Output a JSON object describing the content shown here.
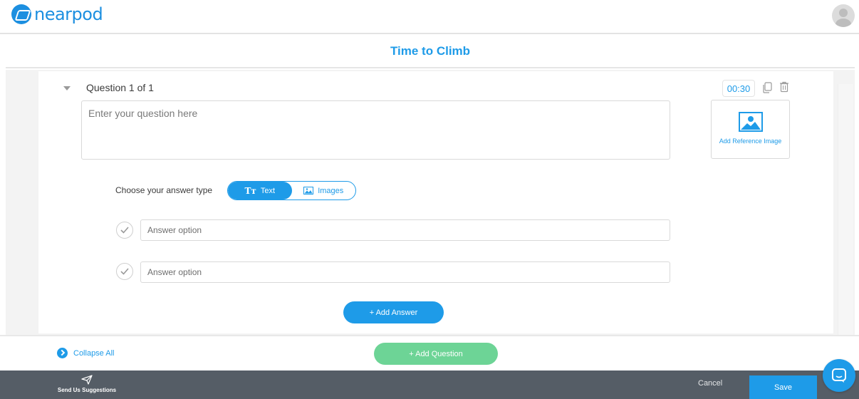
{
  "app": {
    "brand": "nearpod"
  },
  "page": {
    "title": "Time to Climb"
  },
  "question": {
    "label": "Question 1 of 1",
    "timer": "00:30",
    "placeholder": "Enter your question here",
    "reference_image_label": "Add Reference Image"
  },
  "answer_type": {
    "label": "Choose your answer type",
    "options": [
      {
        "label": "Text",
        "icon": "text-type-icon",
        "selected": true
      },
      {
        "label": "Images",
        "icon": "image-icon",
        "selected": false
      }
    ]
  },
  "answers": [
    {
      "placeholder": "Answer option"
    },
    {
      "placeholder": "Answer option"
    }
  ],
  "buttons": {
    "add_answer": "+ Add Answer",
    "add_question": "+ Add Question",
    "collapse_all": "Collapse All",
    "send_suggestions": "Send Us Suggestions",
    "cancel": "Cancel",
    "save": "Save"
  },
  "colors": {
    "primary": "#1e9be8",
    "add_question": "#6dd496",
    "footer": "#555d66"
  }
}
